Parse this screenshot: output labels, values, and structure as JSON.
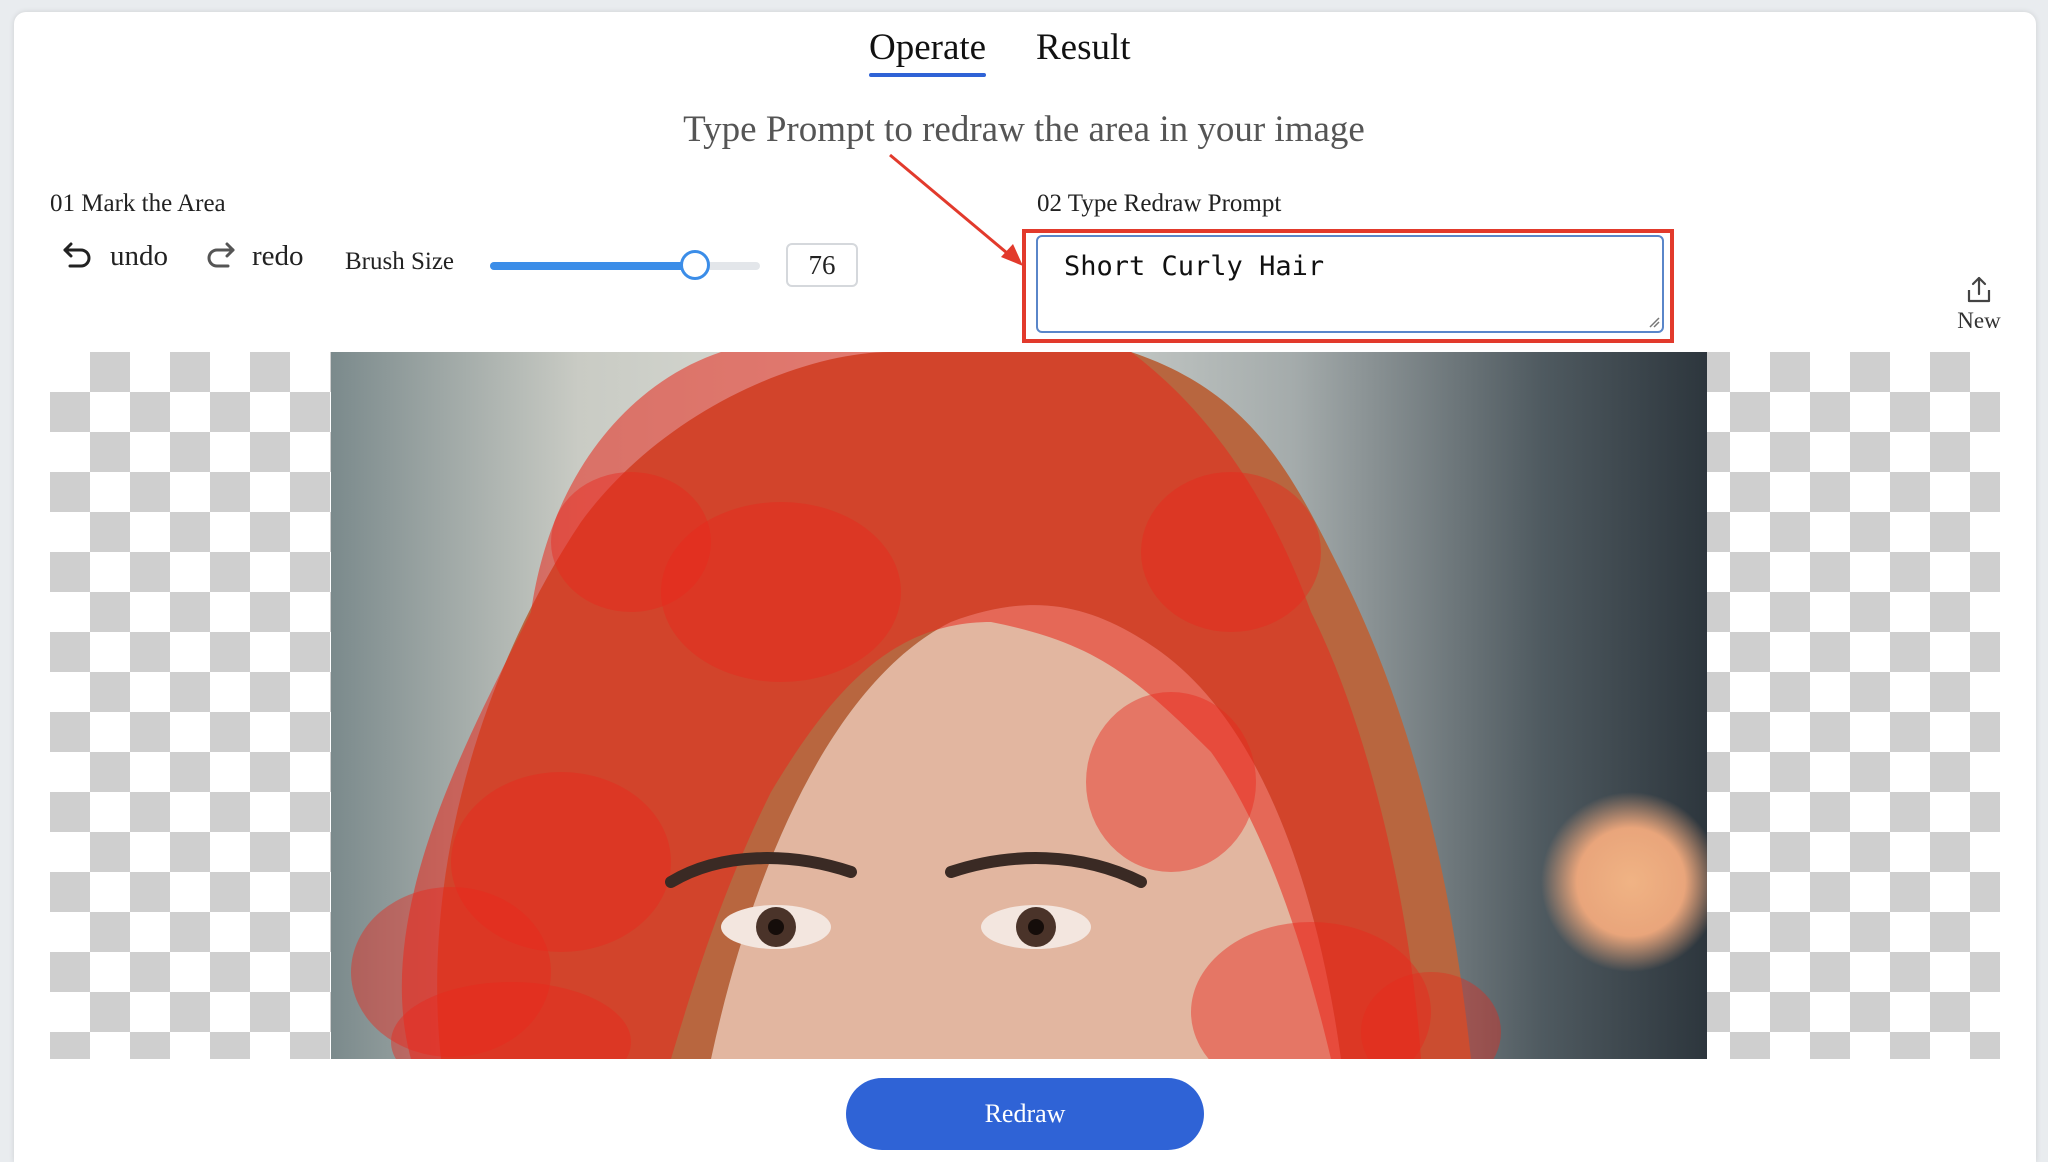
{
  "tabs": [
    {
      "label": "Operate",
      "active": true
    },
    {
      "label": "Result",
      "active": false
    }
  ],
  "headline": "Type Prompt to redraw the area in your image",
  "mark_area": {
    "label": "01 Mark the Area",
    "undo_label": "undo",
    "redo_label": "redo",
    "brush_size_label": "Brush Size",
    "brush_size_value": "76",
    "brush_slider_fraction": 0.76
  },
  "prompt": {
    "label": "02 Type Redraw Prompt",
    "value": "Short Curly Hair"
  },
  "new_button": {
    "label": "New",
    "icon": "upload-icon"
  },
  "redraw_button": {
    "label": "Redraw"
  },
  "colors": {
    "accent": "#2f63d6",
    "slider": "#3b8de8",
    "highlight": "#e23a2c",
    "mask": "#e8281c"
  }
}
